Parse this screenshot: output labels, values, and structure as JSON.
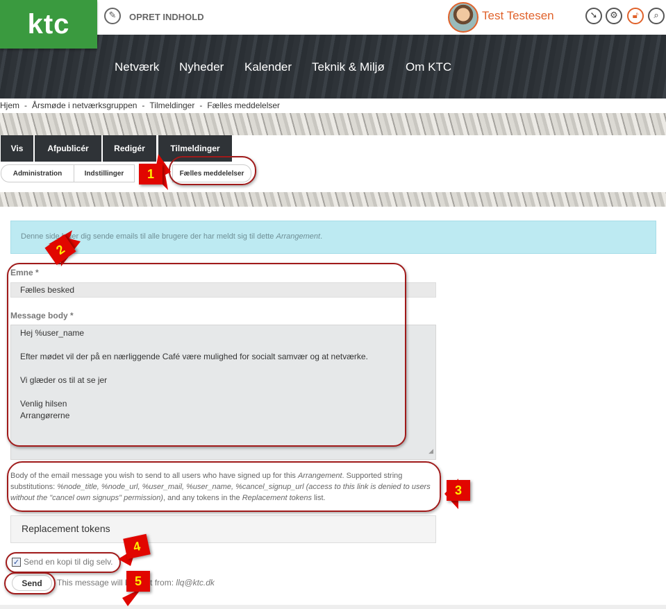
{
  "header": {
    "logo": "ktc",
    "create_label": "OPRET INDHOLD",
    "user_name": "Test Testesen",
    "icons": [
      "edit-icon",
      "dial-icon",
      "gear-icon",
      "lock-icon",
      "search-icon"
    ]
  },
  "nav": {
    "items": [
      "Netværk",
      "Nyheder",
      "Kalender",
      "Teknik & Miljø",
      "Om KTC"
    ]
  },
  "breadcrumb": [
    "Hjem",
    "Årsmøde i netværksgruppen",
    "Tilmeldinger",
    "Fælles meddelelser"
  ],
  "tabs": [
    "Vis",
    "Afpublicér",
    "Redigér",
    "Tilmeldinger"
  ],
  "subtabs": [
    "Administration",
    "Indstillinger",
    "Fælles meddelelser"
  ],
  "info": {
    "text": "Denne side lader dig sende emails til alle brugere der har meldt sig til dette ",
    "emphasis": "Arrangement",
    "end": "."
  },
  "form": {
    "subject_label": "Emne *",
    "subject_value": "Fælles besked",
    "body_label": "Message body *",
    "body_lines": [
      "Hej %user_name",
      "",
      "Efter mødet vil der på en nærliggende Café være mulighed for socialt samvær og at netværke.",
      "",
      "Vi glæder os til at se jer",
      "",
      "Venlig hilsen",
      "Arrangørerne"
    ],
    "help_1": "Body of the email message you wish to send to all users who have signed up for this ",
    "help_em_1": "Arrangement",
    "help_2": ". Supported string substitutions: ",
    "help_em_2": "%node_title, %node_url, %user_mail, %user_name, %cancel_signup_url (access to this link is denied to users without the \"cancel own signups\" permission)",
    "help_3": ", and any tokens in the ",
    "help_em_3": "Replacement tokens",
    "help_4": " list.",
    "tokens_label": "Replacement tokens",
    "copy_label": "Send en kopi til dig selv.",
    "copy_checked": true,
    "send_label": "Send",
    "send_note": "This message will be sent from: ",
    "send_email": "llq@ktc.dk"
  },
  "annotations": [
    "1",
    "2",
    "3",
    "4",
    "5"
  ],
  "colors": {
    "brand_green": "#3a9a3f",
    "accent_orange": "#e0622b",
    "info_bg": "#bdeaf2",
    "annotation_red": "#e10600",
    "annotation_text": "#ffef00"
  }
}
